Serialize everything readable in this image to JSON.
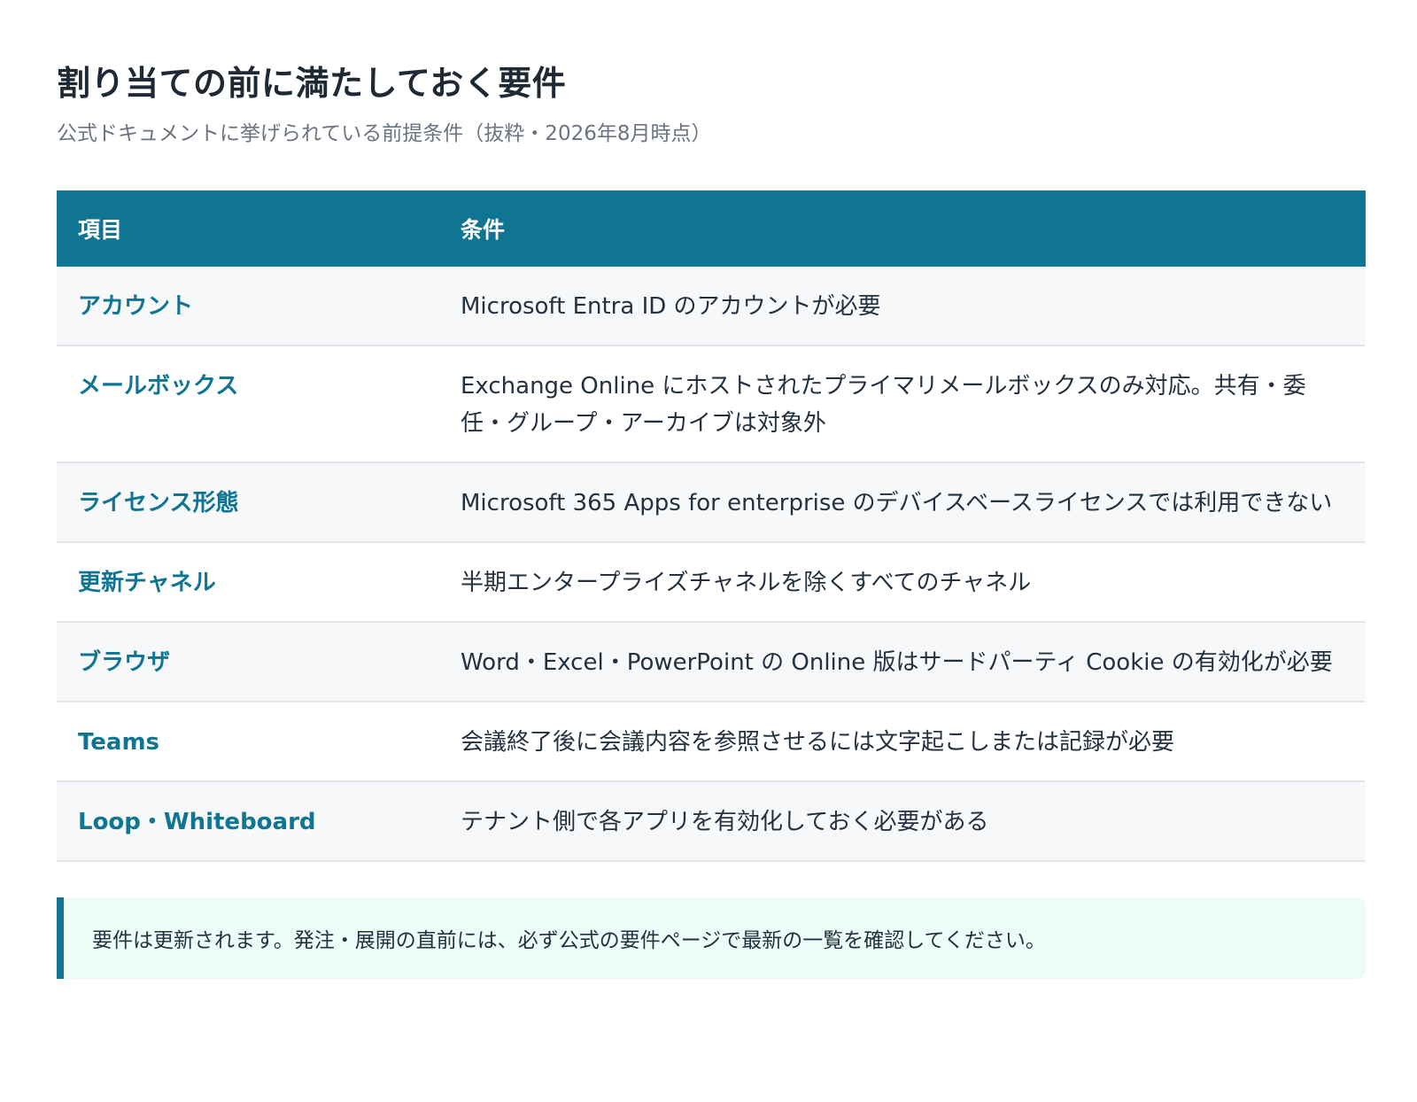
{
  "header": {
    "title": "割り当ての前に満たしておく要件",
    "subtitle": "公式ドキュメントに挙げられている前提条件（抜粋・2026年8月時点）"
  },
  "table": {
    "columns": [
      "項目",
      "条件"
    ],
    "rows": [
      {
        "item": "アカウント",
        "condition": "Microsoft Entra ID のアカウントが必要"
      },
      {
        "item": "メールボックス",
        "condition": "Exchange Online にホストされたプライマリメールボックスのみ対応。共有・委任・グループ・アーカイブは対象外"
      },
      {
        "item": "ライセンス形態",
        "condition": "Microsoft 365 Apps for enterprise のデバイスベースライセンスでは利用できない"
      },
      {
        "item": "更新チャネル",
        "condition": "半期エンタープライズチャネルを除くすべてのチャネル"
      },
      {
        "item": "ブラウザ",
        "condition": "Word・Excel・PowerPoint の Online 版はサードパーティ Cookie の有効化が必要"
      },
      {
        "item": "Teams",
        "condition": "会議終了後に会議内容を参照させるには文字起こしまたは記録が必要"
      },
      {
        "item": "Loop・Whiteboard",
        "condition": "テナント側で各アプリを有効化しておく必要がある"
      }
    ]
  },
  "note": {
    "text": "要件は更新されます。発注・展開の直前には、必ず公式の要件ページで最新の一覧を確認してください。"
  },
  "colors": {
    "accent": "#107592",
    "note_background": "#eefcf8",
    "row_alt": "#f6f8fa"
  }
}
